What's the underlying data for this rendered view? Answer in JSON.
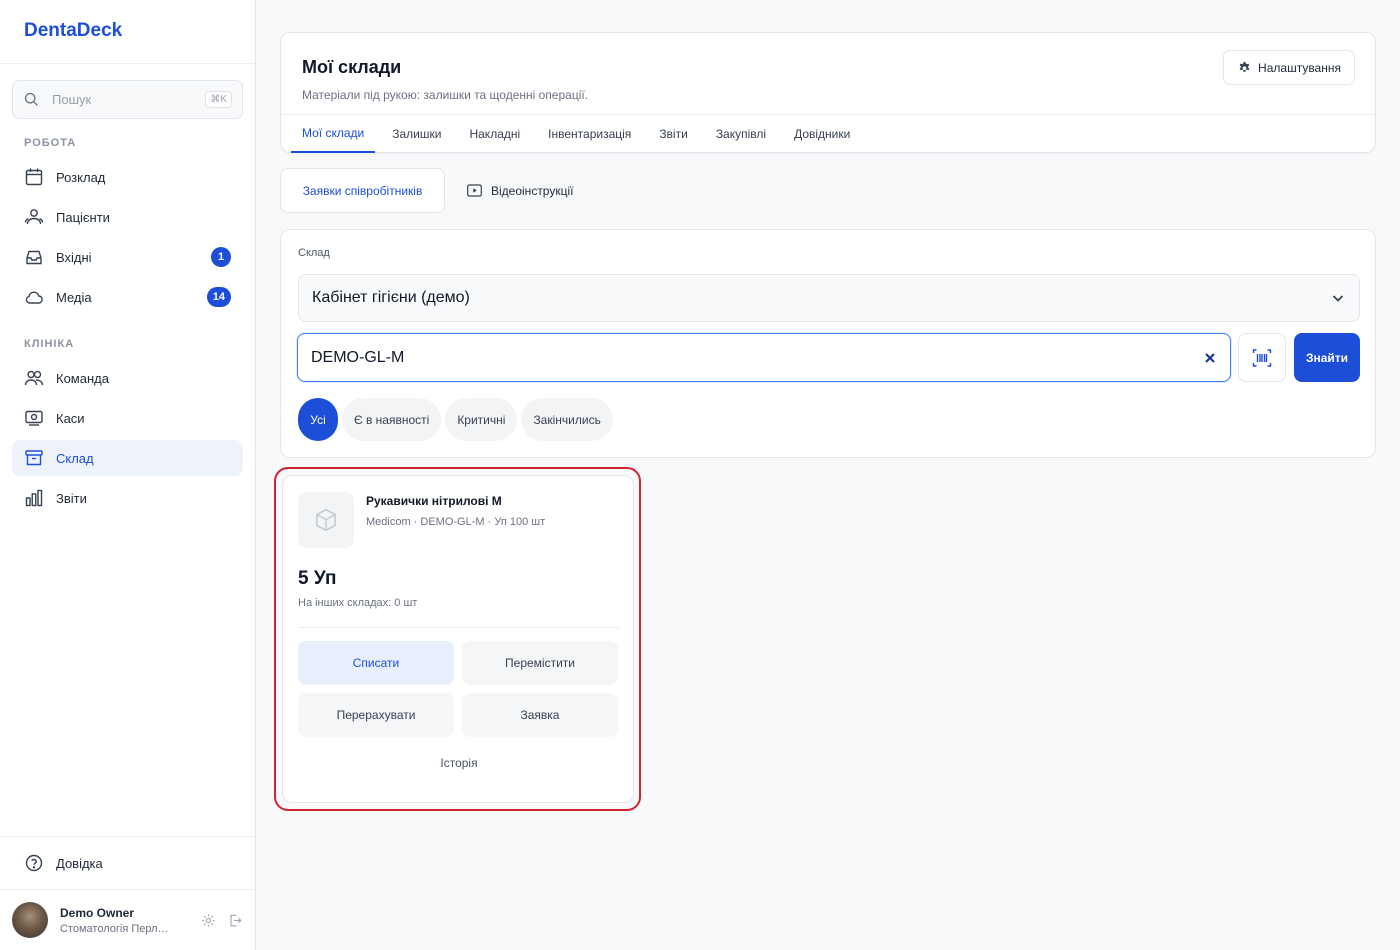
{
  "brand": "DentaDeck",
  "search": {
    "placeholder": "Пошук",
    "shortcut": "⌘K"
  },
  "sidebar": {
    "sections": [
      {
        "label": "РОБОТА"
      },
      {
        "label": "КЛІНІКА"
      }
    ],
    "items": [
      {
        "label": "Розклад",
        "icon": "calendar-icon"
      },
      {
        "label": "Пацієнти",
        "icon": "users-icon"
      },
      {
        "label": "Вхідні",
        "icon": "inbox-icon",
        "badge": "1"
      },
      {
        "label": "Медіа",
        "icon": "cloud-icon",
        "badge": "14"
      },
      {
        "label": "Команда",
        "icon": "team-icon"
      },
      {
        "label": "Каси",
        "icon": "cash-register-icon"
      },
      {
        "label": "Склад",
        "icon": "archive-icon",
        "active": true
      },
      {
        "label": "Звіти",
        "icon": "bar-chart-icon"
      }
    ],
    "help": "Довідка"
  },
  "user": {
    "name": "Demo Owner",
    "org": "Стоматологія Перлина"
  },
  "header": {
    "title": "Мої склади",
    "subtitle": "Матеріали під рукою: залишки та щоденні операції.",
    "settings_label": "Налаштування",
    "tabs": [
      "Мої склади",
      "Залишки",
      "Накладні",
      "Інвентаризація",
      "Звіти",
      "Закупівлі",
      "Довідники"
    ]
  },
  "subtabs": {
    "requests": "Заявки співробітників",
    "videos": "Відеоінструкції"
  },
  "filter": {
    "warehouse_label": "Склад",
    "warehouse_value": "Кабінет гігієни (демо)",
    "query_value": "DEMO-GL-M",
    "find_label": "Знайти",
    "chips": [
      "Усі",
      "Є в наявності",
      "Критичні",
      "Закінчились"
    ]
  },
  "product": {
    "name": "Рукавички нітрилові M",
    "meta": "Medicom · DEMO-GL-M · Уп 100 шт",
    "quantity": "5 Уп",
    "other_stock": "На інших складах: 0 шт",
    "actions": {
      "write_off": "Списати",
      "move": "Перемістити",
      "recount": "Перерахувати",
      "request": "Заявка"
    },
    "history": "Історія"
  },
  "colors": {
    "accent": "#1d4ed8",
    "highlight": "#d1242f"
  }
}
